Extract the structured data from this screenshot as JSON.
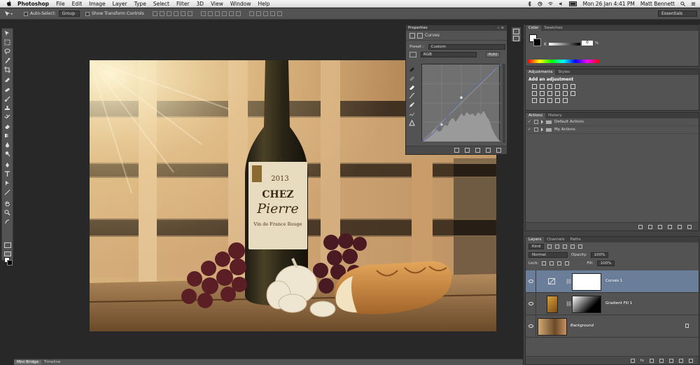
{
  "menubar": {
    "app": "Photoshop",
    "items": [
      "File",
      "Edit",
      "Image",
      "Layer",
      "Type",
      "Select",
      "Filter",
      "3D",
      "View",
      "Window",
      "Help"
    ],
    "datetime": "Mon 26 Jan  4:41 PM",
    "user": "Matt Bennett"
  },
  "options": {
    "auto_select": "Auto-Select:",
    "auto_select_value": "Group",
    "transform_controls": "Show Transform Controls",
    "workspace": "Essentials"
  },
  "properties": {
    "tab": "Properties",
    "adjustment": "Curves",
    "preset_label": "Preset :",
    "preset_value": "Custom",
    "channel": "RGB",
    "auto_button": "Auto",
    "curve_points": [
      [
        0,
        0
      ],
      [
        0.25,
        0.22
      ],
      [
        0.5,
        0.57
      ],
      [
        1,
        1
      ]
    ]
  },
  "color_panel": {
    "tabs": [
      "Color",
      "Swatches"
    ],
    "k_label": "K",
    "k_value": "0",
    "k_unit": "%"
  },
  "adjustments_panel": {
    "tabs": [
      "Adjustments",
      "Styles"
    ],
    "label": "Add an adjustment"
  },
  "actions_panel": {
    "tabs": [
      "Actions",
      "History"
    ],
    "sets": [
      "Default Actions",
      "My Actions"
    ]
  },
  "layers_panel": {
    "tabs": [
      "Layers",
      "Channels",
      "Paths"
    ],
    "filter_kind": "Kind",
    "blend_mode": "Normal",
    "opacity_label": "Opacity:",
    "opacity_value": "100%",
    "lock_label": "Lock:",
    "fill_label": "Fill:",
    "fill_value": "100%",
    "layers": [
      {
        "name": "Curves 1",
        "selected": true
      },
      {
        "name": "Gradient Fill 1",
        "selected": false
      },
      {
        "name": "Background",
        "selected": false
      }
    ]
  },
  "bottom_tabs": [
    "Mini Bridge",
    "Timeline"
  ],
  "photo": {
    "label_year": "2013",
    "label_brand_1": "CHEZ",
    "label_brand_2": "Pierre",
    "label_sub": "Vin de France Rouge"
  }
}
